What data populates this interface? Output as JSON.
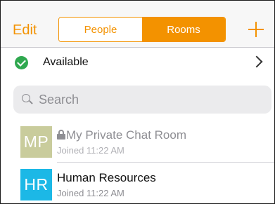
{
  "header": {
    "edit_label": "Edit",
    "tabs": [
      {
        "label": "People",
        "active": false
      },
      {
        "label": "Rooms",
        "active": true
      }
    ],
    "add_icon": "plus-icon",
    "accent_color": "#f39200"
  },
  "status": {
    "label": "Available",
    "icon": "check-circle-icon",
    "status_color": "#2fa84f"
  },
  "search": {
    "placeholder": "Search",
    "value": ""
  },
  "rooms": [
    {
      "initials": "MP",
      "title": "My Private Chat Room",
      "private": true,
      "subtitle": "Joined 11:22 AM",
      "avatar_color": "#c9cc9c"
    },
    {
      "initials": "HR",
      "title": "Human Resources",
      "private": false,
      "subtitle": "Joined 11:22 AM",
      "avatar_color": "#1cb8e6"
    }
  ]
}
